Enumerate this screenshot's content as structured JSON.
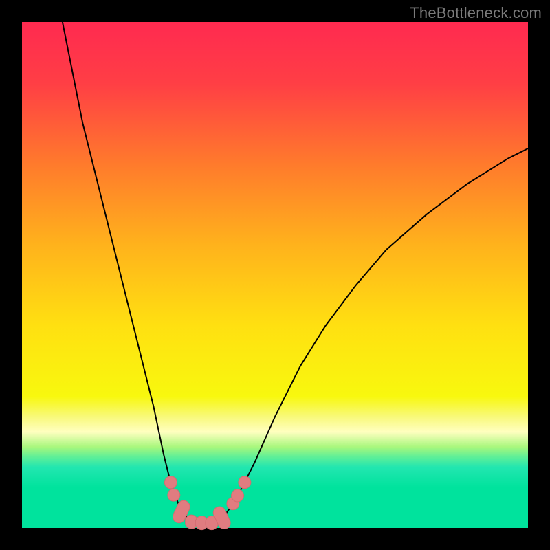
{
  "watermark": "TheBottleneck.com",
  "colors": {
    "page_border": "#000000",
    "gradient_stops": [
      {
        "offset": 0.0,
        "color": "#ff2a50"
      },
      {
        "offset": 0.12,
        "color": "#ff3e45"
      },
      {
        "offset": 0.28,
        "color": "#ff7a2c"
      },
      {
        "offset": 0.44,
        "color": "#ffb21c"
      },
      {
        "offset": 0.6,
        "color": "#ffe011"
      },
      {
        "offset": 0.74,
        "color": "#f8f80e"
      },
      {
        "offset": 0.78,
        "color": "#f8f97a"
      },
      {
        "offset": 0.81,
        "color": "#ffffc0"
      },
      {
        "offset": 0.84,
        "color": "#a8f77d"
      },
      {
        "offset": 0.86,
        "color": "#5def98"
      },
      {
        "offset": 0.88,
        "color": "#22e6b0"
      },
      {
        "offset": 0.92,
        "color": "#00e39d"
      },
      {
        "offset": 1.0,
        "color": "#00e39d"
      }
    ],
    "curve": "#000000",
    "marker_fill": "#e07c80",
    "marker_stroke": "#d36c70"
  },
  "chart_data": {
    "type": "line",
    "title": "",
    "xlabel": "",
    "ylabel": "",
    "xlim": [
      0,
      100
    ],
    "ylim": [
      0,
      100
    ],
    "curve_points": [
      {
        "x": 8.0,
        "y": 100.0
      },
      {
        "x": 10.0,
        "y": 90.0
      },
      {
        "x": 12.0,
        "y": 80.0
      },
      {
        "x": 14.5,
        "y": 70.0
      },
      {
        "x": 17.0,
        "y": 60.0
      },
      {
        "x": 20.0,
        "y": 48.0
      },
      {
        "x": 23.0,
        "y": 36.0
      },
      {
        "x": 26.0,
        "y": 24.0
      },
      {
        "x": 28.0,
        "y": 14.5
      },
      {
        "x": 29.5,
        "y": 8.5
      },
      {
        "x": 31.0,
        "y": 4.5
      },
      {
        "x": 32.5,
        "y": 2.2
      },
      {
        "x": 34.0,
        "y": 1.2
      },
      {
        "x": 35.5,
        "y": 1.0
      },
      {
        "x": 37.0,
        "y": 1.0
      },
      {
        "x": 38.5,
        "y": 1.2
      },
      {
        "x": 40.0,
        "y": 2.4
      },
      {
        "x": 42.0,
        "y": 5.2
      },
      {
        "x": 44.0,
        "y": 9.0
      },
      {
        "x": 46.0,
        "y": 13.0
      },
      {
        "x": 50.0,
        "y": 22.0
      },
      {
        "x": 55.0,
        "y": 32.0
      },
      {
        "x": 60.0,
        "y": 40.0
      },
      {
        "x": 66.0,
        "y": 48.0
      },
      {
        "x": 72.0,
        "y": 55.0
      },
      {
        "x": 80.0,
        "y": 62.0
      },
      {
        "x": 88.0,
        "y": 68.0
      },
      {
        "x": 96.0,
        "y": 73.0
      },
      {
        "x": 100.0,
        "y": 75.0
      }
    ],
    "markers": [
      {
        "x": 29.4,
        "y": 9.0,
        "shape": "circle"
      },
      {
        "x": 30.0,
        "y": 6.5,
        "shape": "circle"
      },
      {
        "x": 31.5,
        "y": 3.2,
        "shape": "rounded-bar"
      },
      {
        "x": 33.5,
        "y": 1.2,
        "shape": "rounded-bar-flat"
      },
      {
        "x": 35.5,
        "y": 1.0,
        "shape": "rounded-bar-flat"
      },
      {
        "x": 37.5,
        "y": 1.0,
        "shape": "rounded-bar-flat"
      },
      {
        "x": 39.5,
        "y": 2.0,
        "shape": "rounded-bar"
      },
      {
        "x": 41.7,
        "y": 4.8,
        "shape": "circle"
      },
      {
        "x": 42.6,
        "y": 6.4,
        "shape": "circle"
      },
      {
        "x": 44.0,
        "y": 9.0,
        "shape": "circle"
      }
    ]
  }
}
